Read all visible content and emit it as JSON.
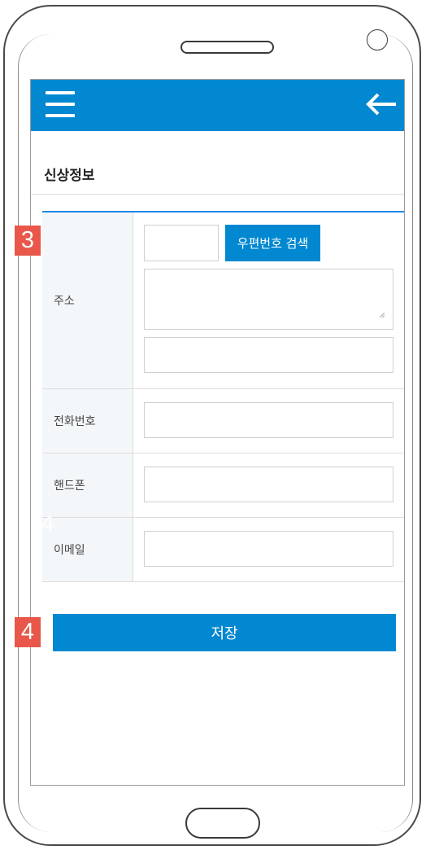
{
  "page": {
    "title": "신상정보"
  },
  "form": {
    "address": {
      "label": "주소",
      "postcode_value": "",
      "search_button": "우편번호 검색",
      "address_value": "",
      "detail_value": ""
    },
    "phone": {
      "label": "전화번호",
      "value": ""
    },
    "mobile": {
      "label": "핸드폰",
      "value": ""
    },
    "email": {
      "label": "이메일",
      "value": ""
    }
  },
  "actions": {
    "save_label": "저장"
  },
  "annotations": {
    "marker_3": "3",
    "marker_4": "4",
    "ghost_4": "4"
  },
  "colors": {
    "primary": "#0288d1",
    "marker": "#e8574a",
    "label_bg": "#f4f7fa"
  }
}
